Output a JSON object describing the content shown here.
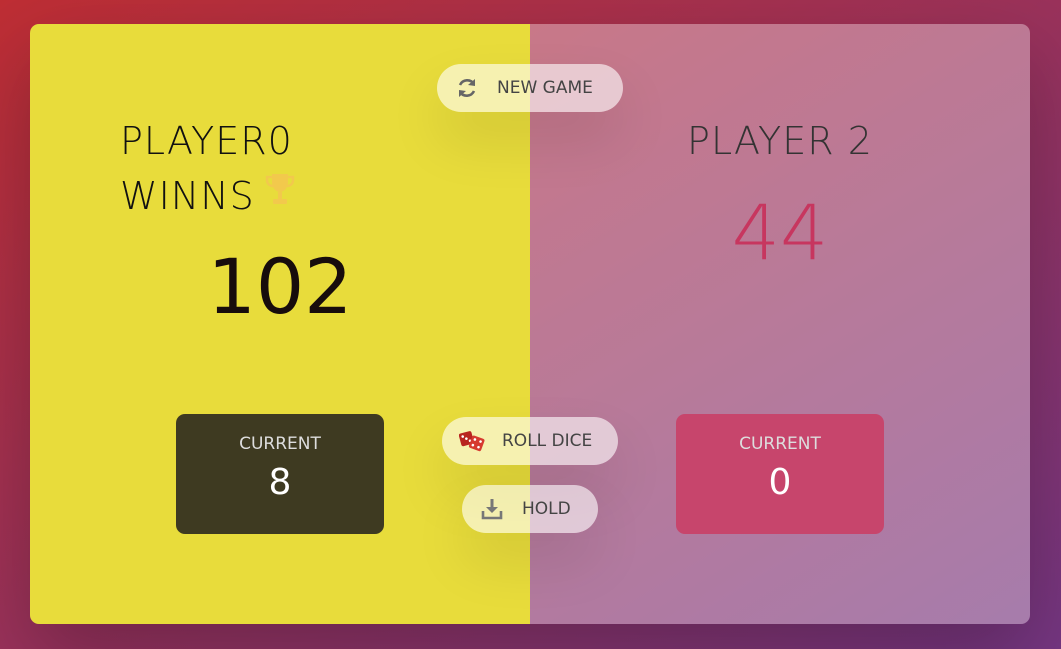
{
  "players": [
    {
      "name_line1": "Player0",
      "name_line2": "winns",
      "score": "102",
      "current_label": "Current",
      "current_score": "8",
      "winner": true
    },
    {
      "name": "Player 2",
      "score": "44",
      "current_label": "Current",
      "current_score": "0",
      "winner": false
    }
  ],
  "buttons": {
    "new_game": {
      "label": "New game",
      "icon": "refresh-icon"
    },
    "roll_dice": {
      "label": "Roll dice",
      "icon": "dice-icon"
    },
    "hold": {
      "label": "Hold",
      "icon": "download-icon"
    }
  },
  "colors": {
    "winner_bg": "#e8dc3b",
    "current_dark": "#3e3a21",
    "current_pink": "#c7456c",
    "score_pink": "#c7365f"
  }
}
